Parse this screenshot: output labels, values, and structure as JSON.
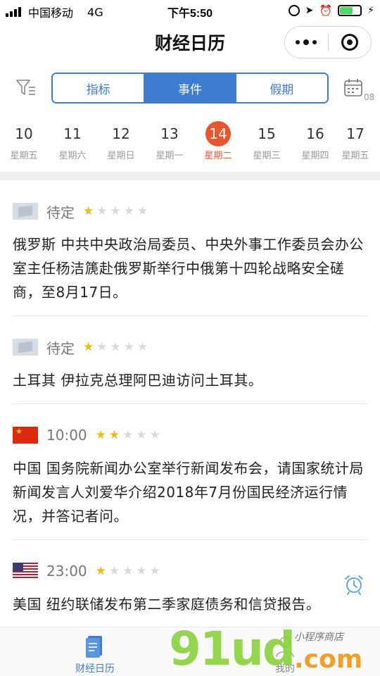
{
  "status_bar": {
    "carrier": "中国移动",
    "network": "4G",
    "time": "下午5:50"
  },
  "nav": {
    "title": "财经日历"
  },
  "tabs": [
    {
      "label": "指标"
    },
    {
      "label": "事件"
    },
    {
      "label": "假期"
    }
  ],
  "calendar_button": {
    "day": "08"
  },
  "dates": [
    {
      "num": "10",
      "weekday": "星期五"
    },
    {
      "num": "11",
      "weekday": "星期六"
    },
    {
      "num": "12",
      "weekday": "星期日"
    },
    {
      "num": "13",
      "weekday": "星期一"
    },
    {
      "num": "14",
      "weekday": "星期二"
    },
    {
      "num": "15",
      "weekday": "星期三"
    },
    {
      "num": "16",
      "weekday": "星期四"
    },
    {
      "num": "17",
      "weekday": "星期五"
    }
  ],
  "selected_date_index": 4,
  "events": [
    {
      "flag": "unknown",
      "time": "待定",
      "importance": 1,
      "max_importance": 5,
      "text": "俄罗斯 中共中央政治局委员、中央外事工作委员会办公室主任杨洁篪赴俄罗斯举行中俄第十四轮战略安全磋商，至8月17日。"
    },
    {
      "flag": "unknown",
      "time": "待定",
      "importance": 1,
      "max_importance": 5,
      "text": "土耳其 伊拉克总理阿巴迪访问土耳其。"
    },
    {
      "flag": "china",
      "time": "10:00",
      "importance": 2,
      "max_importance": 5,
      "text": "中国 国务院新闻办公室举行新闻发布会，请国家统计局新闻发言人刘爱华介绍2018年7月份国民经济运行情况，并答记者问。"
    },
    {
      "flag": "usa",
      "time": "23:00",
      "importance": 1,
      "max_importance": 5,
      "text": "美国 纽约联储发布第二季家庭债务和信贷报告。"
    }
  ],
  "tab_bar": {
    "calendar_label": "财经日历",
    "me_label": "我的"
  },
  "watermark": {
    "main": "91ud",
    "domain": ".com",
    "sub": "小程序商店"
  },
  "colors": {
    "accent": "#3d7ccf",
    "selected_date": "#e8542f",
    "star_on": "#f4b914",
    "star_off": "#d9d9d9"
  }
}
